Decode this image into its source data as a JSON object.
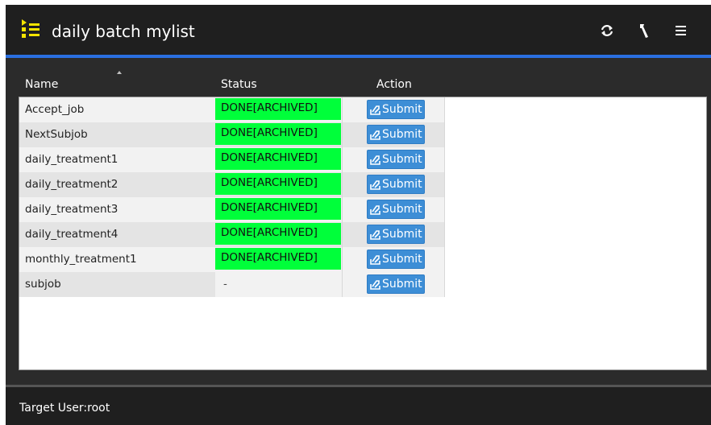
{
  "app": {
    "title": "daily batch mylist",
    "icons": {
      "app": "list-icon",
      "refresh": "refresh-icon",
      "settings": "wrench-icon",
      "menu": "hamburger-menu-icon"
    },
    "colors": {
      "header": "#1f1f1f",
      "accent_line": "#2a6fe0",
      "done_status": "#00ff3a",
      "submit_button": "#3d8ed6",
      "app_icon": "#f5e400"
    }
  },
  "table": {
    "columns": {
      "name": "Name",
      "status": "Status",
      "action": "Action"
    },
    "sort": {
      "column": "name",
      "direction": "ascending"
    },
    "rows": [
      {
        "name": "Accept_job",
        "status": "DONE[ARCHIVED]",
        "action": "Submit"
      },
      {
        "name": "NextSubjob",
        "status": "DONE[ARCHIVED]",
        "action": "Submit"
      },
      {
        "name": "daily_treatment1",
        "status": "DONE[ARCHIVED]",
        "action": "Submit"
      },
      {
        "name": "daily_treatment2",
        "status": "DONE[ARCHIVED]",
        "action": "Submit"
      },
      {
        "name": "daily_treatment3",
        "status": "DONE[ARCHIVED]",
        "action": "Submit"
      },
      {
        "name": "daily_treatment4",
        "status": "DONE[ARCHIVED]",
        "action": "Submit"
      },
      {
        "name": "monthly_treatment1",
        "status": "DONE[ARCHIVED]",
        "action": "Submit"
      },
      {
        "name": "subjob",
        "status": "-",
        "action": "Submit"
      }
    ]
  },
  "footer": {
    "target_user": "Target User:root"
  }
}
